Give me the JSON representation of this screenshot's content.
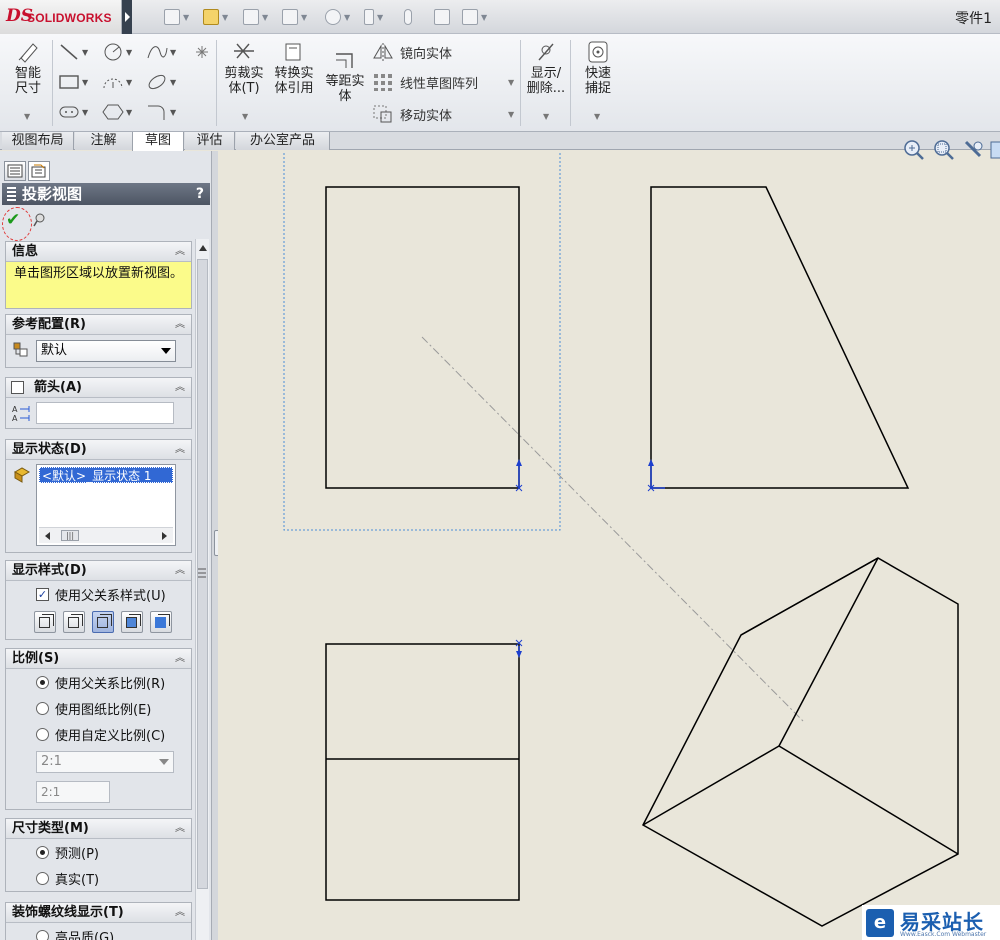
{
  "app": {
    "logo_text": "SOLIDWORKS",
    "logo_mark": "DS",
    "document_title": "零件1 ",
    "accent": "#c8102e"
  },
  "ribbon": {
    "smart_dimension": "智能尺寸",
    "trim": "剪裁实体(T)",
    "convert": "转换实体引用",
    "offset": "等距实体",
    "mirror": "镜向实体",
    "linear_pattern": "线性草图阵列",
    "move": "移动实体",
    "show_delete": "显示/删除...",
    "quick_snap": "快速捕捉"
  },
  "tabs": [
    "视图布局",
    "注解",
    "草图",
    "评估",
    "办公室产品"
  ],
  "active_tab": "草图",
  "property_manager": {
    "title": "投影视图",
    "help": "?",
    "info": {
      "title": "信息",
      "text": "单击图形区域以放置新视图。"
    },
    "reference_config": {
      "title": "参考配置(R)",
      "value": "默认"
    },
    "arrow": {
      "title": "箭头(A)",
      "checked": false,
      "label_value": ""
    },
    "display_state": {
      "title": "显示状态(D)",
      "selected": "<默认>_显示状态 1"
    },
    "display_style": {
      "title": "显示样式(D)",
      "use_parent": "使用父关系样式(U)",
      "use_parent_checked": true
    },
    "scale": {
      "title": "比例(S)",
      "options": [
        "使用父关系比例(R)",
        "使用图纸比例(E)",
        "使用自定义比例(C)"
      ],
      "selected_index": 0,
      "dropdown_value": "2:1",
      "text_value": "2:1"
    },
    "dimension_type": {
      "title": "尺寸类型(M)",
      "options": [
        "预测(P)",
        "真实(T)"
      ],
      "selected_index": 0
    },
    "cosmetic_thread": {
      "title": "装饰螺纹线显示(T)",
      "first_option": "高品质(G)"
    }
  },
  "watermark": {
    "text": "易采站长站",
    "sub": "Www.Easck.Com Webmaster"
  }
}
